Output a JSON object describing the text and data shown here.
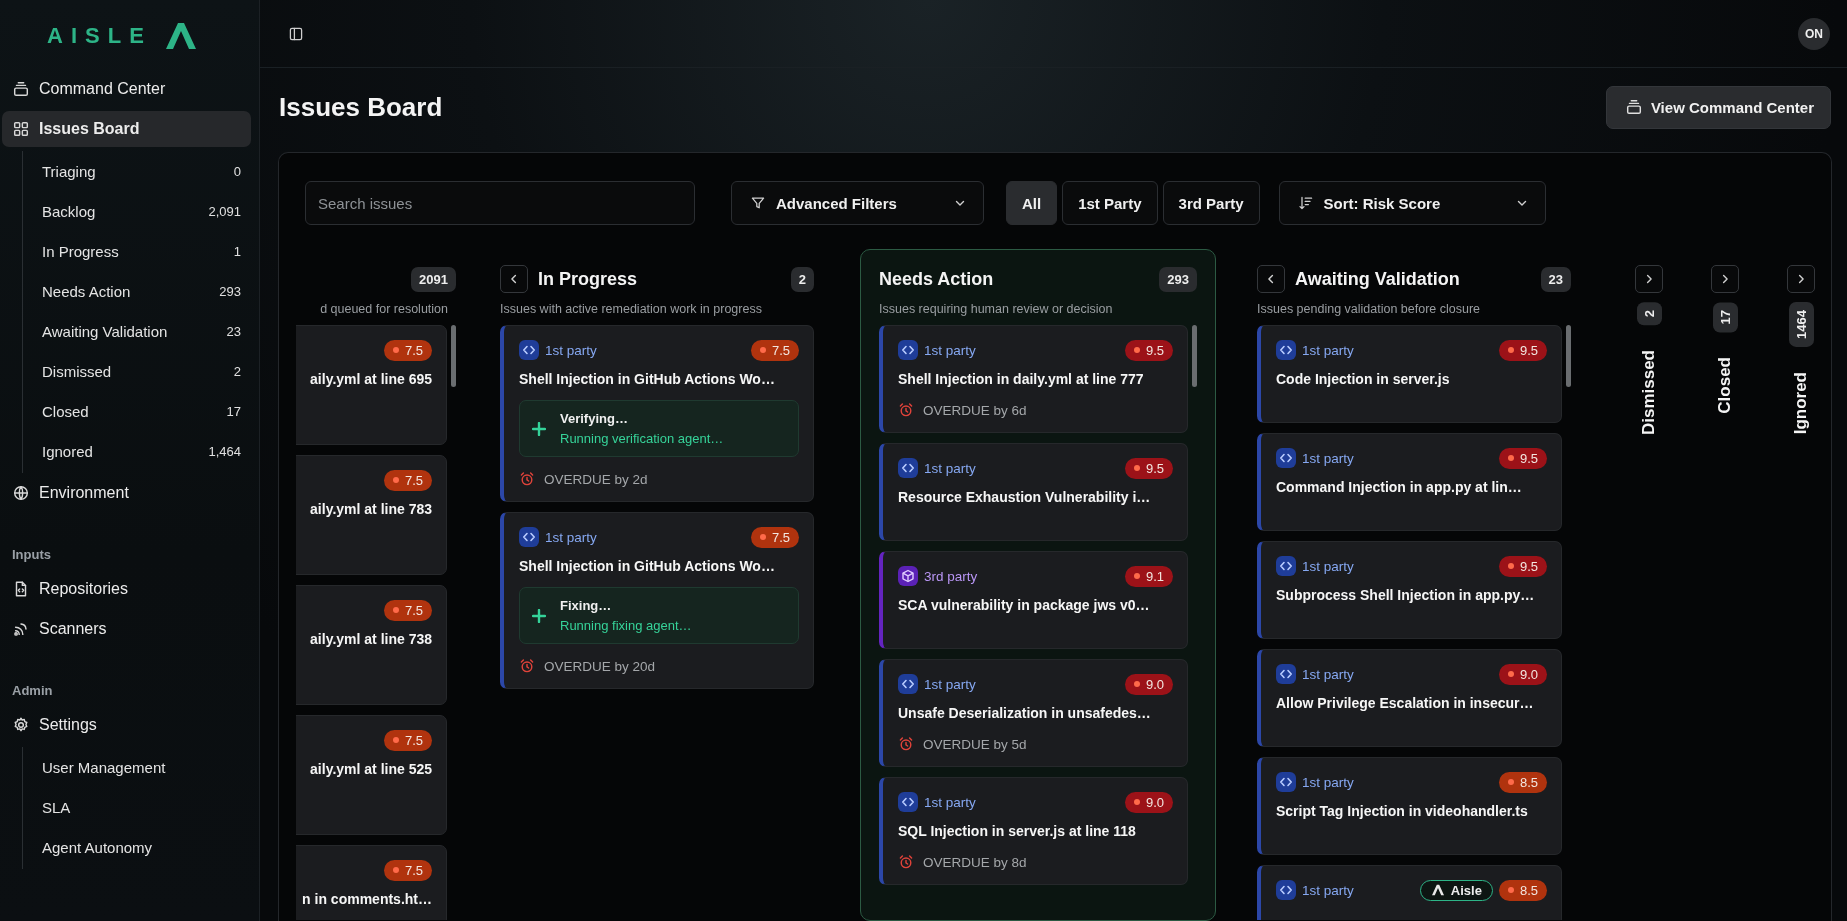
{
  "sidebar": {
    "logo": "AISLE",
    "sections": [
      {
        "items": [
          {
            "label": "Command Center",
            "selected": false
          },
          {
            "label": "Issues Board",
            "selected": true,
            "children": [
              {
                "label": "Triaging",
                "count": "0",
                "selected": false
              },
              {
                "label": "Backlog",
                "count": "2,091",
                "selected": false
              },
              {
                "label": "In Progress",
                "count": "1",
                "selected": false
              },
              {
                "label": "Needs Action",
                "count": "293",
                "selected": false
              },
              {
                "label": "Awaiting Validation",
                "count": "23",
                "selected": false
              },
              {
                "label": "Dismissed",
                "count": "2",
                "selected": false
              },
              {
                "label": "Closed",
                "count": "17",
                "selected": false
              },
              {
                "label": "Ignored",
                "count": "1,464",
                "selected": false
              }
            ]
          },
          {
            "label": "Environment",
            "selected": false
          }
        ]
      },
      {
        "heading": "Inputs",
        "items": [
          {
            "label": "Repositories",
            "selected": false
          },
          {
            "label": "Scanners",
            "selected": false
          }
        ]
      },
      {
        "heading": "Admin",
        "items": [
          {
            "label": "Settings",
            "selected": false,
            "children": [
              {
                "label": "User Management",
                "selected": false
              },
              {
                "label": "SLA",
                "selected": false
              },
              {
                "label": "Agent Autonomy",
                "selected": false
              }
            ]
          }
        ]
      }
    ]
  },
  "topbar": {
    "avatar": "ON"
  },
  "header": {
    "title": "Issues Board",
    "button": "View Command Center"
  },
  "filters": {
    "search": {
      "placeholder": "Search issues"
    },
    "advanced": "Advanced Filters",
    "party_tabs": [
      {
        "label": "All",
        "selected": true
      },
      {
        "label": "1st Party",
        "selected": false
      },
      {
        "label": "3rd Party",
        "selected": false
      }
    ],
    "sort": "Sort: Risk Score"
  },
  "columns": [
    {
      "kind": "clipped",
      "count": "2091",
      "description": "d queued for resolution",
      "cards": [
        {
          "score": "7.5",
          "color": "#b0330e",
          "title": "aily.yml at line 695"
        },
        {
          "score": "7.5",
          "color": "#b0330e",
          "title": "aily.yml at line 783"
        },
        {
          "score": "7.5",
          "color": "#b0330e",
          "title": "aily.yml at line 738"
        },
        {
          "score": "7.5",
          "color": "#b0330e",
          "title": "aily.yml at line 525"
        },
        {
          "score": "7.5",
          "color": "#b0330e",
          "title": "n in comments.ht…"
        }
      ]
    },
    {
      "kind": "expanded",
      "collapsible": true,
      "title": "In Progress",
      "count": "2",
      "description": "Issues with active remediation work in progress",
      "cards": [
        {
          "party": {
            "label": "1st party",
            "kind": "first"
          },
          "score": "7.5",
          "color": "#b0330e",
          "title": "Shell Injection in GitHub Actions Wo…",
          "status": {
            "title": "Verifying…",
            "detail": "Running verification agent…"
          },
          "overdue": "OVERDUE by 2d"
        },
        {
          "party": {
            "label": "1st party",
            "kind": "first"
          },
          "score": "7.5",
          "color": "#b0330e",
          "title": "Shell Injection in GitHub Actions Wo…",
          "status": {
            "title": "Fixing…",
            "detail": "Running fixing agent…"
          },
          "overdue": "OVERDUE by 20d"
        }
      ]
    },
    {
      "kind": "highlighted",
      "collapsible": false,
      "title": "Needs Action",
      "count": "293",
      "description": "Issues requiring human review or decision",
      "cards": [
        {
          "party": {
            "label": "1st party",
            "kind": "first"
          },
          "score": "9.5",
          "color": "#9c1218",
          "title": "Shell Injection in daily.yml at line 777",
          "overdue": "OVERDUE by 6d"
        },
        {
          "party": {
            "label": "1st party",
            "kind": "first"
          },
          "score": "9.5",
          "color": "#9c1218",
          "title": "Resource Exhaustion Vulnerability i…"
        },
        {
          "party": {
            "label": "3rd party",
            "kind": "third"
          },
          "score": "9.1",
          "color": "#9c1218",
          "title": "SCA vulnerability in package jws v0…"
        },
        {
          "party": {
            "label": "1st party",
            "kind": "first"
          },
          "score": "9.0",
          "color": "#9c1218",
          "title": "Unsafe Deserialization in unsafedes…",
          "overdue": "OVERDUE by 5d"
        },
        {
          "party": {
            "label": "1st party",
            "kind": "first"
          },
          "score": "9.0",
          "color": "#9c1218",
          "title": "SQL Injection in server.js at line 118",
          "overdue": "OVERDUE by 8d"
        }
      ]
    },
    {
      "kind": "expanded",
      "collapsible": true,
      "title": "Awaiting Validation",
      "count": "23",
      "description": "Issues pending validation before closure",
      "cards": [
        {
          "party": {
            "label": "1st party",
            "kind": "first"
          },
          "score": "9.5",
          "color": "#9c1218",
          "title": "Code Injection in server.js"
        },
        {
          "party": {
            "label": "1st party",
            "kind": "first"
          },
          "score": "9.5",
          "color": "#9c1218",
          "title": "Command Injection in app.py at lin…"
        },
        {
          "party": {
            "label": "1st party",
            "kind": "first"
          },
          "score": "9.5",
          "color": "#9c1218",
          "title": "Subprocess Shell Injection in app.py…"
        },
        {
          "party": {
            "label": "1st party",
            "kind": "first"
          },
          "score": "9.0",
          "color": "#9c1218",
          "title": "Allow Privilege Escalation in insecur…"
        },
        {
          "party": {
            "label": "1st party",
            "kind": "first"
          },
          "score": "8.5",
          "color": "#b0330e",
          "title": "Script Tag Injection in videohandler.ts"
        },
        {
          "party": {
            "label": "1st party",
            "kind": "first"
          },
          "agent": "Aisle",
          "score": "8.5",
          "color": "#b0330e"
        }
      ]
    },
    {
      "kind": "collapsed",
      "title": "Dismissed",
      "count": "2"
    },
    {
      "kind": "collapsed",
      "title": "Closed",
      "count": "17"
    },
    {
      "kind": "collapsed",
      "title": "Ignored",
      "count": "1464"
    }
  ]
}
